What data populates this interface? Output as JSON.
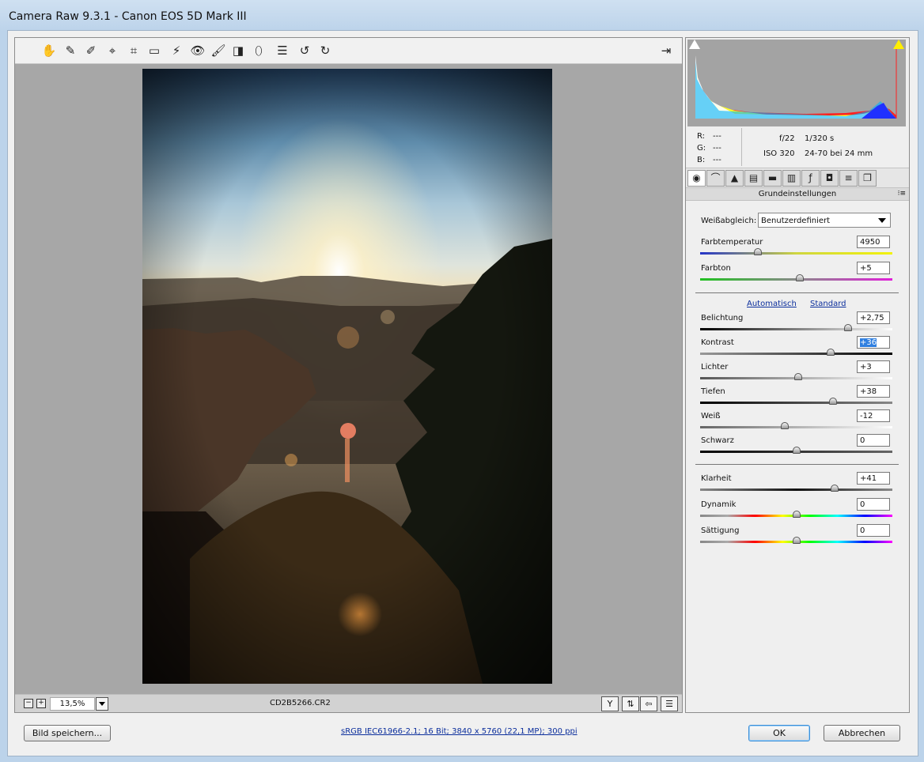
{
  "window": {
    "title": "Camera Raw 9.3.1 - Canon EOS 5D Mark III"
  },
  "toolbar": {
    "tools": [
      {
        "name": "hand-tool",
        "glyph": "✋"
      },
      {
        "name": "white-balance-tool",
        "glyph": "✎"
      },
      {
        "name": "color-sampler-tool",
        "glyph": "✐"
      },
      {
        "name": "targeted-adjustment-tool",
        "glyph": "⌖"
      },
      {
        "name": "crop-tool",
        "glyph": "⌗"
      },
      {
        "name": "straighten-tool",
        "glyph": "▭"
      },
      {
        "name": "spot-removal-tool",
        "glyph": "⚡"
      },
      {
        "name": "red-eye-tool",
        "glyph": "👁"
      },
      {
        "name": "adjustment-brush-tool",
        "glyph": "🖌"
      },
      {
        "name": "graduated-filter-tool",
        "glyph": "◨"
      },
      {
        "name": "radial-filter-tool",
        "glyph": "⬯"
      },
      {
        "name": "preferences-tool",
        "glyph": "☰"
      },
      {
        "name": "rotate-left-tool",
        "glyph": "↺"
      },
      {
        "name": "rotate-right-tool",
        "glyph": "↻"
      }
    ],
    "fullscreen_glyph": "⇥"
  },
  "statusbar": {
    "zoom_minus": "−",
    "zoom_plus": "+",
    "zoom_value": "13,5%",
    "filename": "CD2B5266.CR2"
  },
  "histogram": {
    "rgb_labels": {
      "r": "R:",
      "g": "G:",
      "b": "B:"
    },
    "rgb_values": {
      "r": "---",
      "g": "---",
      "b": "---"
    },
    "aperture": "f/22",
    "shutter": "1/320 s",
    "iso": "ISO 320",
    "lens": "24-70 bei 24 mm"
  },
  "panel": {
    "section_title": "Grundeinstellungen",
    "white_balance_label": "Weißabgleich:",
    "white_balance_value": "Benutzerdefiniert",
    "auto_link": "Automatisch",
    "default_link": "Standard",
    "sliders": [
      {
        "label": "Farbtemperatur",
        "value": "4950",
        "level": 0.3
      },
      {
        "label": "Farbton",
        "value": "+5",
        "level": 0.52
      },
      {
        "label": "Belichtung",
        "value": "+2,75",
        "level": 0.77
      },
      {
        "label": "Kontrast",
        "value": "+36",
        "level": 0.68
      },
      {
        "label": "Lichter",
        "value": "+3",
        "level": 0.51
      },
      {
        "label": "Tiefen",
        "value": "+38",
        "level": 0.69
      },
      {
        "label": "Weiß",
        "value": "-12",
        "level": 0.44
      },
      {
        "label": "Schwarz",
        "value": "0",
        "level": 0.5
      },
      {
        "label": "Klarheit",
        "value": "+41",
        "level": 0.7
      },
      {
        "label": "Dynamik",
        "value": "0",
        "level": 0.5
      },
      {
        "label": "Sättigung",
        "value": "0",
        "level": 0.5
      }
    ]
  },
  "footer": {
    "save_button": "Bild speichern...",
    "workflow_info": "sRGB IEC61966-2.1; 16 Bit; 3840 x 5760 (22,1 MP); 300 ppi",
    "ok_button": "OK",
    "cancel_button": "Abbrechen"
  }
}
